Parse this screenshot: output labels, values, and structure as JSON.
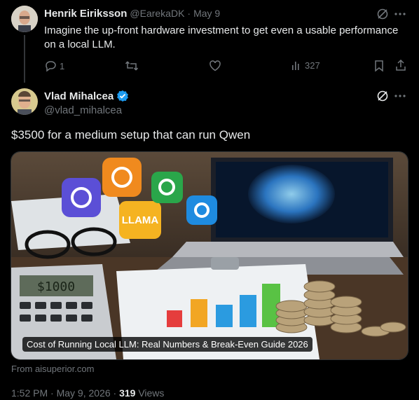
{
  "reply": {
    "author_name": "Henrik Eiriksson",
    "handle": "@EarekaDK",
    "separator": "·",
    "date": "May 9",
    "text_line1": "Imagine the up-front hardware investment to get even a usable performance",
    "text_line2": "on a local LLM.",
    "reply_count": "1",
    "views_count": "327"
  },
  "main": {
    "author_name": "Vlad Mihalcea",
    "handle": "@vlad_mihalcea",
    "text": "$3500 for a medium setup that can run Qwen",
    "card": {
      "caption": "Cost of Running Local LLM: Real Numbers & Break-Even Guide 2026",
      "source": "From aisuperior.com",
      "calculator_display": "$1000",
      "llama_label": "LLAMA"
    },
    "timestamp": "1:52 PM · May 9, 2026 · ",
    "views_number": "319",
    "views_label": " Views"
  },
  "colors": {
    "background": "#000000",
    "text": "#e7e9ea",
    "muted": "#71767b",
    "verified": "#1d9bf0"
  }
}
